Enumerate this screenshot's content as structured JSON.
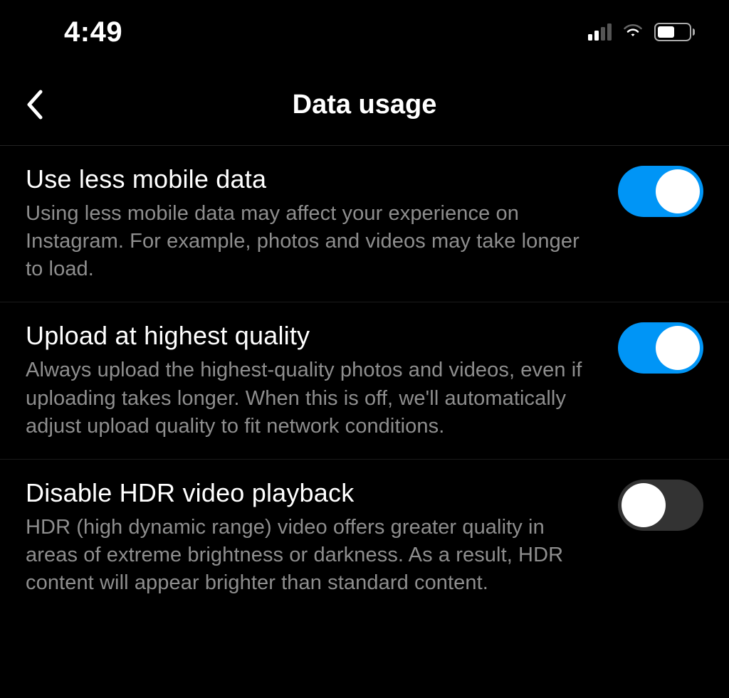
{
  "status_bar": {
    "time": "4:49",
    "cellular_bars": 2,
    "cellular_total": 4,
    "battery_percent": 55
  },
  "header": {
    "title": "Data usage"
  },
  "settings": [
    {
      "id": "use-less-mobile-data",
      "title": "Use less mobile data",
      "description": "Using less mobile data may affect your experience on Instagram. For example, photos and videos may take longer to load.",
      "enabled": true
    },
    {
      "id": "upload-highest-quality",
      "title": "Upload at highest quality",
      "description": "Always upload the highest-quality photos and videos, even if uploading takes longer. When this is off, we'll automatically adjust upload quality to fit network conditions.",
      "enabled": true
    },
    {
      "id": "disable-hdr-playback",
      "title": "Disable HDR video playback",
      "description": "HDR (high dynamic range) video offers greater quality in areas of extreme brightness or darkness. As a result, HDR content will appear brighter than standard content.",
      "enabled": false
    }
  ]
}
